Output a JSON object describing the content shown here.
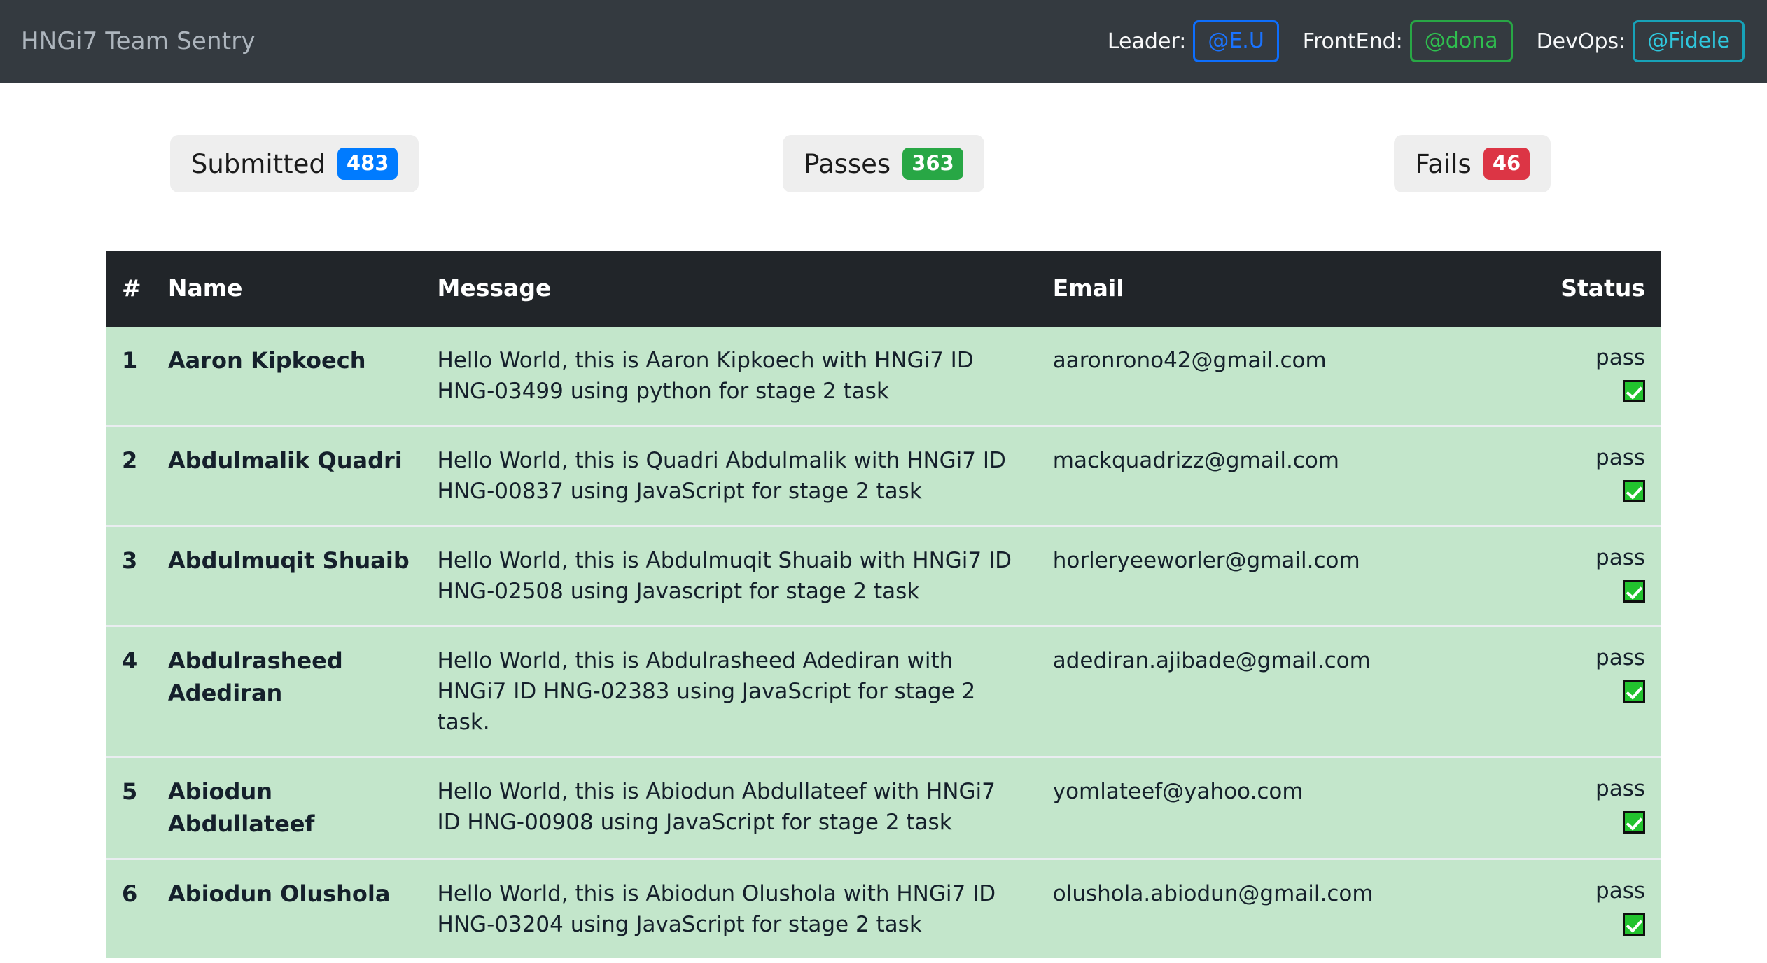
{
  "navbar": {
    "brand": "HNGi7 Team Sentry",
    "members": [
      {
        "role_label": "Leader:",
        "handle": "@E.U",
        "color": "#0d6efd",
        "style": "pill-blue"
      },
      {
        "role_label": "FrontEnd:",
        "handle": "@dona",
        "color": "#28a745",
        "style": "pill-green"
      },
      {
        "role_label": "DevOps:",
        "handle": "@Fidele",
        "color": "#17a2b8",
        "style": "pill-cyan"
      }
    ]
  },
  "stats": [
    {
      "label": "Submitted",
      "count": "483",
      "badge_color": "#007bff",
      "badge_class": "badge-primary"
    },
    {
      "label": "Passes",
      "count": "363",
      "badge_color": "#28a745",
      "badge_class": "badge-success"
    },
    {
      "label": "Fails",
      "count": "46",
      "badge_color": "#dc3545",
      "badge_class": "badge-danger"
    }
  ],
  "table": {
    "headers": {
      "num": "#",
      "name": "Name",
      "message": "Message",
      "email": "Email",
      "status": "Status"
    },
    "rows": [
      {
        "num": "1",
        "name": "Aaron Kipkoech",
        "message": "Hello World, this is Aaron Kipkoech with HNGi7 ID HNG-03499 using python for stage 2 task",
        "email": "aaronrono42@gmail.com",
        "status": "pass",
        "status_icon": "check-mark-button-icon"
      },
      {
        "num": "2",
        "name": "Abdulmalik Quadri",
        "message": "Hello World, this is Quadri Abdulmalik with HNGi7 ID HNG-00837 using JavaScript for stage 2 task",
        "email": "mackquadrizz@gmail.com",
        "status": "pass",
        "status_icon": "check-mark-button-icon"
      },
      {
        "num": "3",
        "name": "Abdulmuqit Shuaib",
        "message": "Hello World, this is Abdulmuqit Shuaib with HNGi7 ID HNG-02508 using Javascript for stage 2 task",
        "email": "horleryeeworler@gmail.com",
        "status": "pass",
        "status_icon": "check-mark-button-icon"
      },
      {
        "num": "4",
        "name": "Abdulrasheed Adediran",
        "message": "Hello World, this is Abdulrasheed Adediran with HNGi7 ID HNG-02383 using JavaScript for stage 2 task.",
        "email": "adediran.ajibade@gmail.com",
        "status": "pass",
        "status_icon": "check-mark-button-icon"
      },
      {
        "num": "5",
        "name": "Abiodun Abdullateef",
        "message": "Hello World, this is Abiodun Abdullateef with HNGi7 ID HNG-00908 using JavaScript for stage 2 task",
        "email": "yomlateef@yahoo.com",
        "status": "pass",
        "status_icon": "check-mark-button-icon"
      },
      {
        "num": "6",
        "name": "Abiodun Olushola",
        "message": "Hello World, this is Abiodun Olushola with HNGi7 ID HNG-03204 using JavaScript for stage 2 task",
        "email": "olushola.abiodun@gmail.com",
        "status": "pass",
        "status_icon": "check-mark-button-icon"
      }
    ]
  },
  "theme": {
    "navbar_bg": "#343a40",
    "table_header_bg": "#212529",
    "row_success_bg": "#c3e6cb",
    "page_bg": "#ffffff"
  }
}
